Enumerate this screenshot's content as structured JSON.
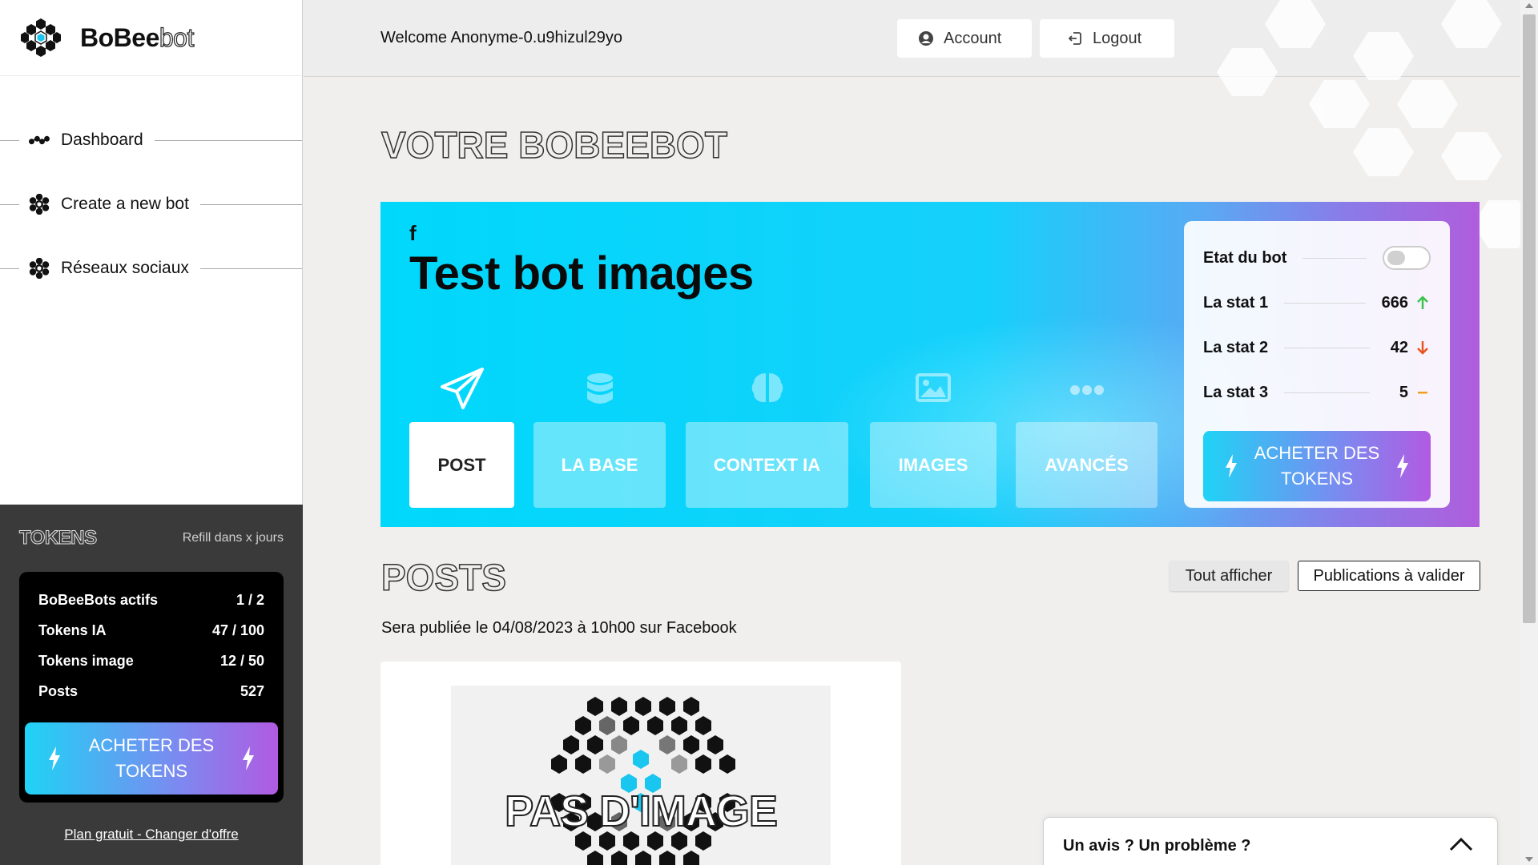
{
  "app": {
    "brand_bold": "BoBee",
    "brand_thin": "bot"
  },
  "sidebar": {
    "items": [
      {
        "label": "Dashboard",
        "icon": "dots-icon"
      },
      {
        "label": "Create a new bot",
        "icon": "hex-flower-icon"
      },
      {
        "label": "Réseaux sociaux",
        "icon": "hex-flower-icon"
      }
    ]
  },
  "tokens": {
    "title": "TOKENS",
    "refill": "Refill dans x jours",
    "rows": [
      {
        "label": "BoBeeBots actifs",
        "value": "1 / 2"
      },
      {
        "label": "Tokens IA",
        "value": "47 / 100"
      },
      {
        "label": "Tokens image",
        "value": "12 / 50"
      },
      {
        "label": "Posts",
        "value": "527"
      }
    ],
    "buy_line1": "ACHETER DES",
    "buy_line2": "TOKENS",
    "plan_link": "Plan gratuit - Changer d'offre"
  },
  "topbar": {
    "welcome": "Welcome Anonyme-0.u9hizul29yo",
    "account": "Account",
    "logout": "Logout"
  },
  "main": {
    "page_title": "VOTRE BOBEEBOT",
    "bot": {
      "network_icon": "f",
      "title": "Test bot images",
      "tabs": [
        {
          "label": "POST",
          "icon": "paper-plane-icon",
          "active": true
        },
        {
          "label": "LA BASE",
          "icon": "database-icon",
          "active": false
        },
        {
          "label": "CONTEXT IA",
          "icon": "brain-icon",
          "active": false
        },
        {
          "label": "IMAGES",
          "icon": "image-icon",
          "active": false
        },
        {
          "label": "AVANCÉS",
          "icon": "ellipsis-icon",
          "active": false
        }
      ],
      "stats": {
        "state_label": "Etat du bot",
        "state_on": false,
        "rows": [
          {
            "label": "La stat 1",
            "value": "666",
            "trend": "up",
            "color": "#3cc24a"
          },
          {
            "label": "La stat 2",
            "value": "42",
            "trend": "down",
            "color": "#e8541f"
          },
          {
            "label": "La stat 3",
            "value": "5",
            "trend": "flat",
            "color": "#f0a020"
          }
        ],
        "buy_line1": "ACHETER DES",
        "buy_line2": "TOKENS"
      }
    },
    "posts": {
      "title": "POSTS",
      "show_all": "Tout afficher",
      "to_validate": "Publications à valider",
      "note": "Sera publiée le 04/08/2023 à 10h00 sur Facebook",
      "placeholder_text": "PAS D'IMAGE"
    }
  },
  "feedback": {
    "label": "Un avis ? Un problème ?"
  },
  "colors": {
    "hero_start": "#00d8fb",
    "hero_end": "#b05ddc",
    "sidebar_dark": "#3a3a3a"
  }
}
